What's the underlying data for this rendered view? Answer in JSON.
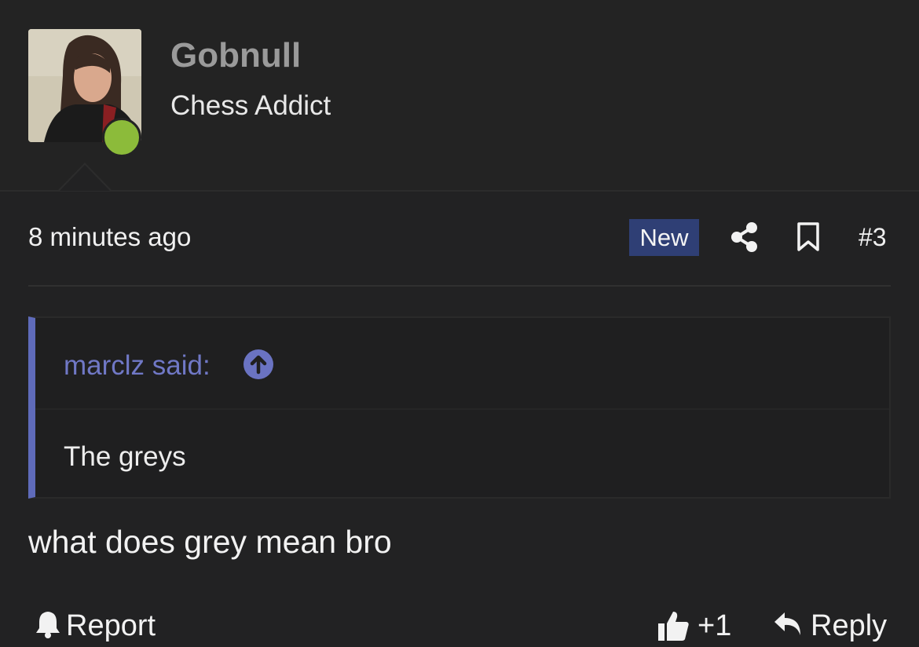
{
  "user": {
    "name": "Gobnull",
    "title": "Chess Addict",
    "online_color": "#8cbb3a"
  },
  "meta": {
    "timestamp": "8 minutes ago",
    "badge": "New",
    "badge_color": "#2f3f75",
    "post_number": "#3",
    "icons": [
      "share-icon",
      "bookmark-icon"
    ]
  },
  "quote": {
    "author": "marclz said:",
    "text": "The greys",
    "accent_color": "#5f6bba",
    "icon": "arrow-up-circle-icon"
  },
  "post": {
    "body": "what does grey mean bro"
  },
  "actions": {
    "report_label": "Report",
    "like_count": "+1",
    "reply_label": "Reply",
    "icons": [
      "bell-icon",
      "thumbs-up-icon",
      "reply-arrow-icon"
    ]
  }
}
